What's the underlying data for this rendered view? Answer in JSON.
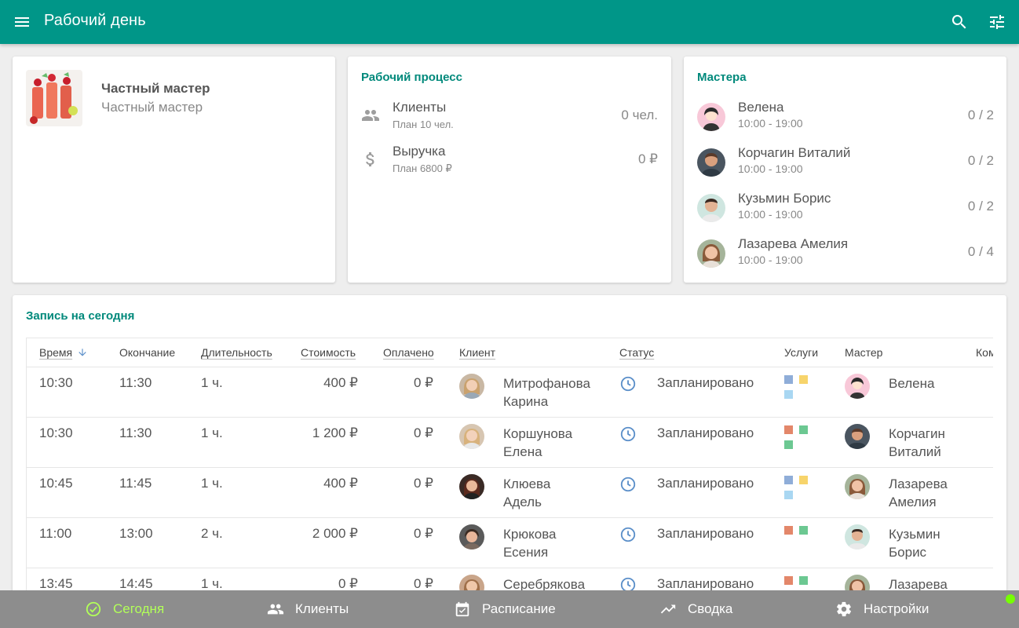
{
  "appbar": {
    "title": "Рабочий день"
  },
  "profile": {
    "name": "Частный мастер",
    "role": "Частный мастер"
  },
  "process": {
    "title": "Рабочий процесс",
    "rows": [
      {
        "label": "Клиенты",
        "plan": "План 10 чел.",
        "value": "0 чел.",
        "icon": "people-icon"
      },
      {
        "label": "Выручка",
        "plan": "План 6800 ₽",
        "value": "0 ₽",
        "icon": "dollar-icon"
      }
    ]
  },
  "masters": {
    "title": "Мастера",
    "items": [
      {
        "name": "Велена",
        "hours": "10:00 - 19:00",
        "load": "0 / 2"
      },
      {
        "name": "Корчагин Виталий",
        "hours": "10:00 - 19:00",
        "load": "0 / 2"
      },
      {
        "name": "Кузьмин Борис",
        "hours": "10:00 - 19:00",
        "load": "0 / 2"
      },
      {
        "name": "Лазарева Амелия",
        "hours": "10:00 - 19:00",
        "load": "0 / 4"
      }
    ]
  },
  "appointments": {
    "title": "Запись на сегодня",
    "columns": {
      "time": "Время",
      "end": "Окончание",
      "duration": "Длительность",
      "cost": "Стоимость",
      "paid": "Оплачено",
      "client": "Клиент",
      "status": "Статус",
      "services": "Услуги",
      "master": "Мастер",
      "comment": "Ком"
    },
    "rows": [
      {
        "time": "10:30",
        "end": "11:30",
        "duration": "1 ч.",
        "cost": "400 ₽",
        "paid": "0 ₽",
        "client1": "Митрофанова",
        "client2": "Карина",
        "status": "Запланировано",
        "master1": "Велена",
        "master2": ""
      },
      {
        "time": "10:30",
        "end": "11:30",
        "duration": "1 ч.",
        "cost": "1 200 ₽",
        "paid": "0 ₽",
        "client1": "Коршунова",
        "client2": "Елена",
        "status": "Запланировано",
        "master1": "Корчагин",
        "master2": "Виталий"
      },
      {
        "time": "10:45",
        "end": "11:45",
        "duration": "1 ч.",
        "cost": "400 ₽",
        "paid": "0 ₽",
        "client1": "Клюева",
        "client2": "Адель",
        "status": "Запланировано",
        "master1": "Лазарева",
        "master2": "Амелия"
      },
      {
        "time": "11:00",
        "end": "13:00",
        "duration": "2 ч.",
        "cost": "2 000 ₽",
        "paid": "0 ₽",
        "client1": "Крюкова",
        "client2": "Есения",
        "status": "Запланировано",
        "master1": "Кузьмин",
        "master2": "Борис"
      },
      {
        "time": "13:45",
        "end": "14:45",
        "duration": "1 ч.",
        "cost": "0 ₽",
        "paid": "0 ₽",
        "client1": "Серебрякова",
        "client2": "",
        "status": "Запланировано",
        "master1": "Лазарева",
        "master2": ""
      }
    ]
  },
  "bottomnav": {
    "items": [
      {
        "label": "Сегодня",
        "icon": "check-circle-icon"
      },
      {
        "label": "Клиенты",
        "icon": "people-icon"
      },
      {
        "label": "Расписание",
        "icon": "calendar-icon"
      },
      {
        "label": "Сводка",
        "icon": "trending-icon"
      },
      {
        "label": "Настройки",
        "icon": "gear-icon"
      }
    ]
  },
  "colors": {
    "primary": "#009688",
    "accent_text": "#00897b",
    "nav_bg": "#8d8d8d",
    "nav_active": "#b2ff59",
    "status_clock": "#5b8fc9",
    "service_blue": "#8fadd8",
    "service_yellow": "#f7d46b",
    "service_lightblue": "#a9d7f2",
    "service_orange": "#e3876a",
    "service_green": "#6cc892"
  }
}
